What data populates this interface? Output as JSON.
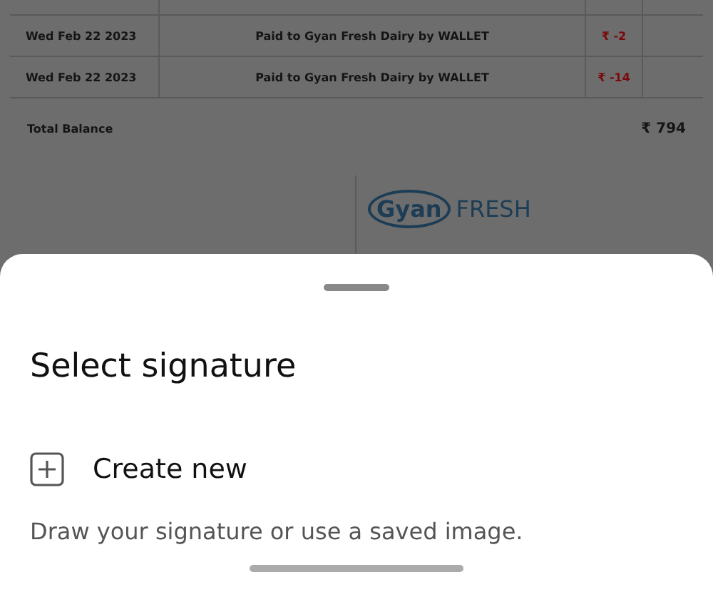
{
  "statement": {
    "rows": [
      {
        "date": "Wed Feb 22 2023",
        "description": "Paid to Gyan Fresh Dairy by WALLET",
        "amount": "₹ -2"
      },
      {
        "date": "Wed Feb 22 2023",
        "description": "Paid to Gyan Fresh Dairy by WALLET",
        "amount": "₹ -14"
      }
    ],
    "total_label": "Total Balance",
    "total_value": "₹ 794",
    "logo": {
      "word1": "Gyan",
      "word2": "FRESH"
    }
  },
  "sheet": {
    "title": "Select signature",
    "action": "Create new",
    "hint": "Draw your signature or use a saved image."
  }
}
